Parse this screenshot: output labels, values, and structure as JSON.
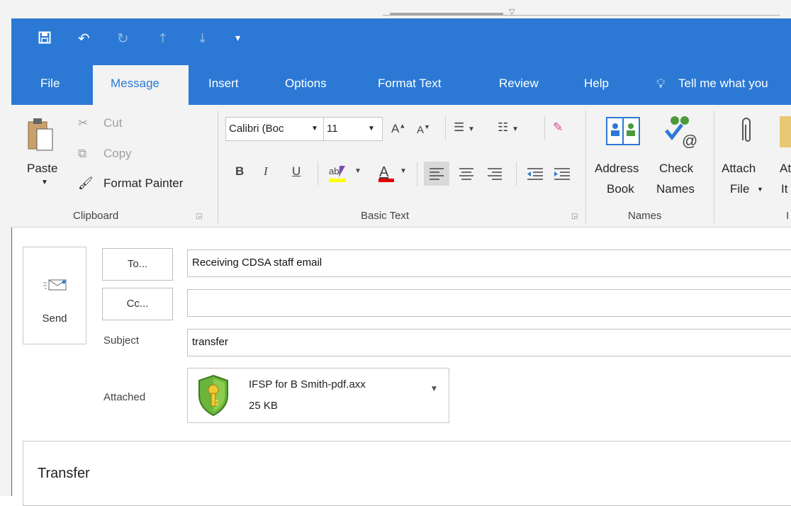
{
  "quick_access": {
    "more_label": "▾"
  },
  "tabs": [
    {
      "label": "File"
    },
    {
      "label": "Message"
    },
    {
      "label": "Insert"
    },
    {
      "label": "Options"
    },
    {
      "label": "Format Text"
    },
    {
      "label": "Review"
    },
    {
      "label": "Help"
    },
    {
      "label": "Tell me what you"
    }
  ],
  "clipboard": {
    "paste": "Paste",
    "cut": "Cut",
    "copy": "Copy",
    "format_painter": "Format Painter",
    "group": "Clipboard"
  },
  "basic_text": {
    "font_name": "Calibri (Boc",
    "font_size": "11",
    "bold": "B",
    "italic": "I",
    "underline": "U",
    "group": "Basic Text"
  },
  "names": {
    "address_book_1": "Address",
    "address_book_2": "Book",
    "check_names_1": "Check",
    "check_names_2": "Names",
    "group": "Names"
  },
  "include": {
    "attach_file_1": "Attach",
    "attach_file_2": "File",
    "attach_item_1": "At",
    "attach_item_2": "It",
    "group": "I"
  },
  "compose": {
    "send": "Send",
    "to_button": "To...",
    "cc_button": "Cc...",
    "to_value": "Receiving CDSA staff email",
    "cc_value": "",
    "subject_label": "Subject",
    "subject_value": "transfer",
    "attached_label": "Attached",
    "attachment_name": "IFSP for B Smith-pdf.axx",
    "attachment_size": "25 KB",
    "body_text": "Transfer"
  },
  "colors": {
    "accent": "#2b79d4",
    "highlight": "#ffff00",
    "font_color": "#e00000"
  }
}
